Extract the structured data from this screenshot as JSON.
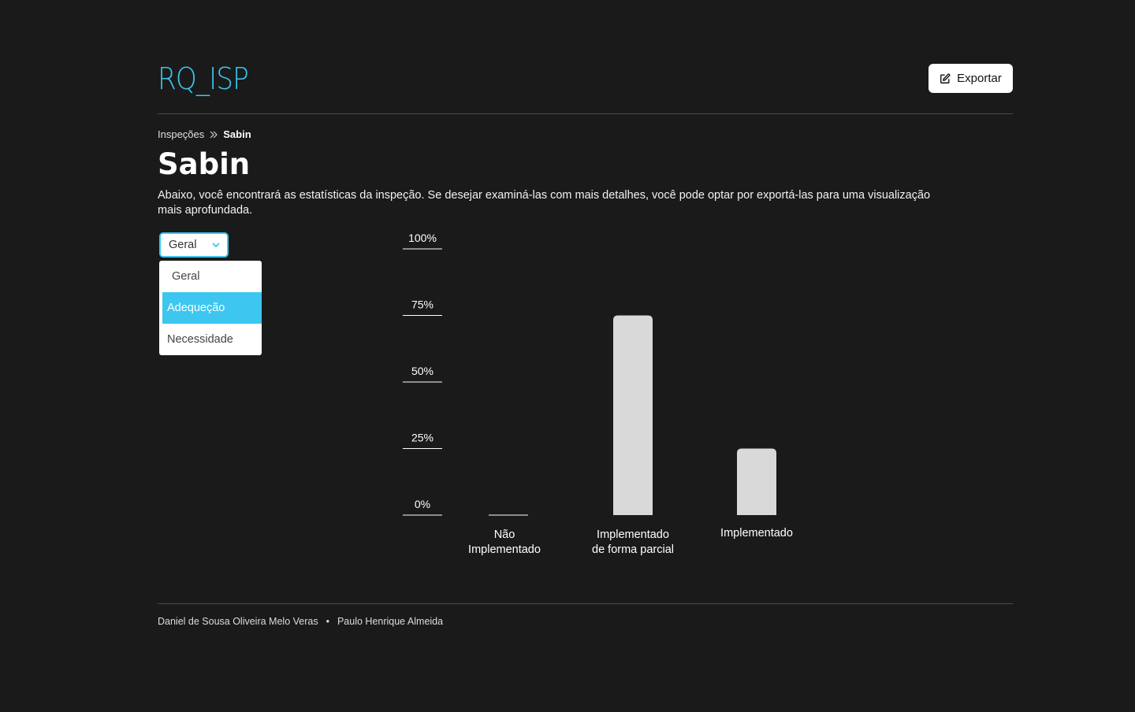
{
  "header": {
    "logo_text": "RQ_ISP",
    "export_label": "Exportar",
    "export_icon": "edit-icon"
  },
  "breadcrumb": {
    "parent": "Inspeções",
    "separator_icon": "double-chevron-right-icon",
    "current": "Sabin"
  },
  "page": {
    "title": "Sabin",
    "description": "Abaixo, você encontrará as estatísticas da inspeção. Se desejar examiná-las com mais detalhes, você pode optar por exportá-las para uma visualização mais aprofundada."
  },
  "filter": {
    "selected": "Geral",
    "options": [
      "Geral",
      "Adequeção",
      "Necessidade"
    ],
    "highlighted": "Adequeção"
  },
  "colors": {
    "background": "#1a1a1a",
    "accent": "#3cc6f0",
    "bar": "#d9d9d9"
  },
  "chart_data": {
    "type": "bar",
    "categories": [
      [
        "Não",
        "Implementado"
      ],
      [
        "Implementado",
        "de forma parcial"
      ],
      [
        "Implementado"
      ]
    ],
    "values": [
      0,
      75,
      25
    ],
    "ylim": [
      0,
      100
    ],
    "yticks": [
      "0%",
      "25%",
      "50%",
      "75%",
      "100%"
    ],
    "grid": false
  },
  "footer": {
    "authors": [
      "Daniel de Sousa Oliveira Melo Veras",
      "Paulo Henrique Almeida"
    ],
    "separator": "•"
  }
}
